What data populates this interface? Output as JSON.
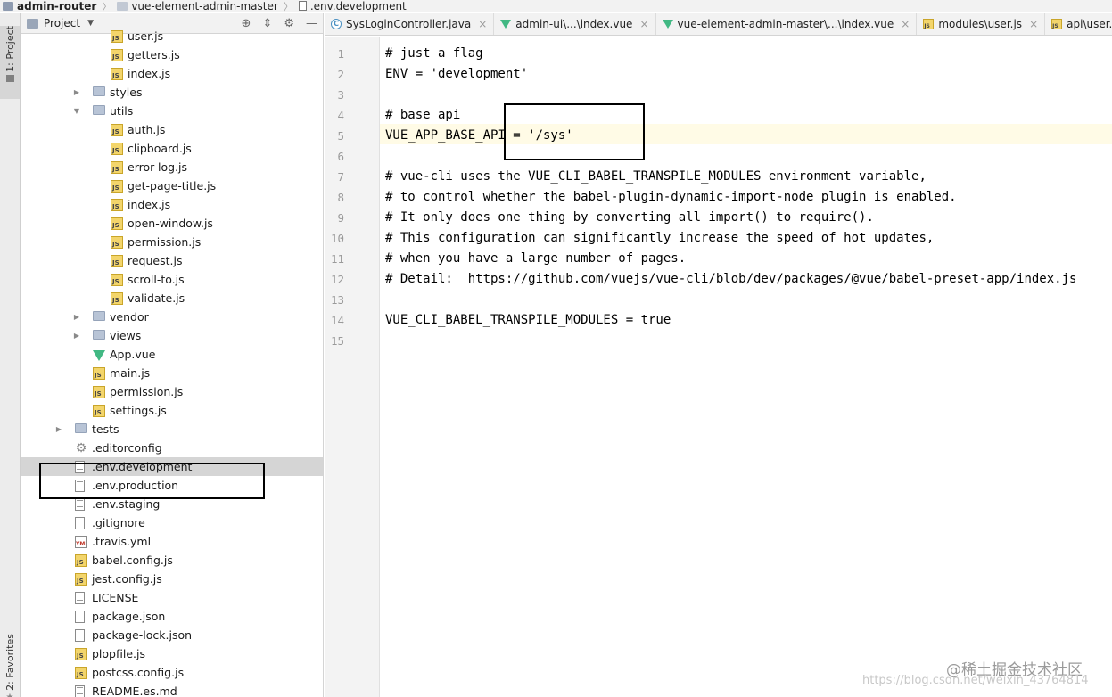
{
  "breadcrumb": {
    "items": [
      "admin-router",
      "vue-element-admin-master",
      ".env.development"
    ]
  },
  "toolstrip": {
    "project_tab": "1: Project",
    "favorites_tab": "2: Favorites"
  },
  "project_panel": {
    "title": "Project",
    "tools": [
      "⊕",
      "⇕",
      "⚙",
      "—"
    ]
  },
  "tree": [
    {
      "label": "user.js",
      "icon": "js",
      "depth": 4
    },
    {
      "label": "getters.js",
      "icon": "js",
      "depth": 4
    },
    {
      "label": "index.js",
      "icon": "js",
      "depth": 4
    },
    {
      "label": "styles",
      "icon": "folder",
      "depth": 3,
      "arrow": "▶"
    },
    {
      "label": "utils",
      "icon": "folder",
      "depth": 3,
      "arrow": "▼"
    },
    {
      "label": "auth.js",
      "icon": "js",
      "depth": 4
    },
    {
      "label": "clipboard.js",
      "icon": "js",
      "depth": 4
    },
    {
      "label": "error-log.js",
      "icon": "js",
      "depth": 4
    },
    {
      "label": "get-page-title.js",
      "icon": "js",
      "depth": 4
    },
    {
      "label": "index.js",
      "icon": "js",
      "depth": 4
    },
    {
      "label": "open-window.js",
      "icon": "js",
      "depth": 4
    },
    {
      "label": "permission.js",
      "icon": "js",
      "depth": 4
    },
    {
      "label": "request.js",
      "icon": "js",
      "depth": 4
    },
    {
      "label": "scroll-to.js",
      "icon": "js",
      "depth": 4
    },
    {
      "label": "validate.js",
      "icon": "js",
      "depth": 4
    },
    {
      "label": "vendor",
      "icon": "folder",
      "depth": 3,
      "arrow": "▶"
    },
    {
      "label": "views",
      "icon": "folder",
      "depth": 3,
      "arrow": "▶"
    },
    {
      "label": "App.vue",
      "icon": "vue",
      "depth": 3
    },
    {
      "label": "main.js",
      "icon": "js",
      "depth": 3
    },
    {
      "label": "permission.js",
      "icon": "js",
      "depth": 3
    },
    {
      "label": "settings.js",
      "icon": "js",
      "depth": 3
    },
    {
      "label": "tests",
      "icon": "folder",
      "depth": 2,
      "arrow": "▶"
    },
    {
      "label": ".editorconfig",
      "icon": "gear",
      "depth": 2
    },
    {
      "label": ".env.development",
      "icon": "text",
      "depth": 2,
      "selected": true
    },
    {
      "label": ".env.production",
      "icon": "text",
      "depth": 2
    },
    {
      "label": ".env.staging",
      "icon": "text",
      "depth": 2
    },
    {
      "label": ".gitignore",
      "icon": "ignore",
      "depth": 2
    },
    {
      "label": ".travis.yml",
      "icon": "yml",
      "depth": 2
    },
    {
      "label": "babel.config.js",
      "icon": "js",
      "depth": 2
    },
    {
      "label": "jest.config.js",
      "icon": "js",
      "depth": 2
    },
    {
      "label": "LICENSE",
      "icon": "text",
      "depth": 2
    },
    {
      "label": "package.json",
      "icon": "json",
      "depth": 2
    },
    {
      "label": "package-lock.json",
      "icon": "json",
      "depth": 2
    },
    {
      "label": "plopfile.js",
      "icon": "js",
      "depth": 2
    },
    {
      "label": "postcss.config.js",
      "icon": "js",
      "depth": 2
    },
    {
      "label": "README.es.md",
      "icon": "text",
      "depth": 2
    }
  ],
  "tabs": [
    {
      "label": "SysLoginController.java",
      "icon": "java"
    },
    {
      "label": "admin-ui\\...\\index.vue",
      "icon": "vue"
    },
    {
      "label": "vue-element-admin-master\\...\\index.vue",
      "icon": "vue"
    },
    {
      "label": "modules\\user.js",
      "icon": "js"
    },
    {
      "label": "api\\user.js",
      "icon": "js"
    }
  ],
  "code_lines": [
    "# just a flag",
    "ENV = 'development'",
    "",
    "# base api",
    "VUE_APP_BASE_API = '/sys'",
    "",
    "# vue-cli uses the VUE_CLI_BABEL_TRANSPILE_MODULES environment variable,",
    "# to control whether the babel-plugin-dynamic-import-node plugin is enabled.",
    "# It only does one thing by converting all import() to require().",
    "# This configuration can significantly increase the speed of hot updates,",
    "# when you have a large number of pages.",
    "# Detail:  https://github.com/vuejs/vue-cli/blob/dev/packages/@vue/babel-preset-app/index.js",
    "",
    "VUE_CLI_BABEL_TRANSPILE_MODULES = true",
    ""
  ],
  "watermark": {
    "brand": "@稀土掘金技术社区",
    "url": "https://blog.csdn.net/weixin_43764814"
  }
}
